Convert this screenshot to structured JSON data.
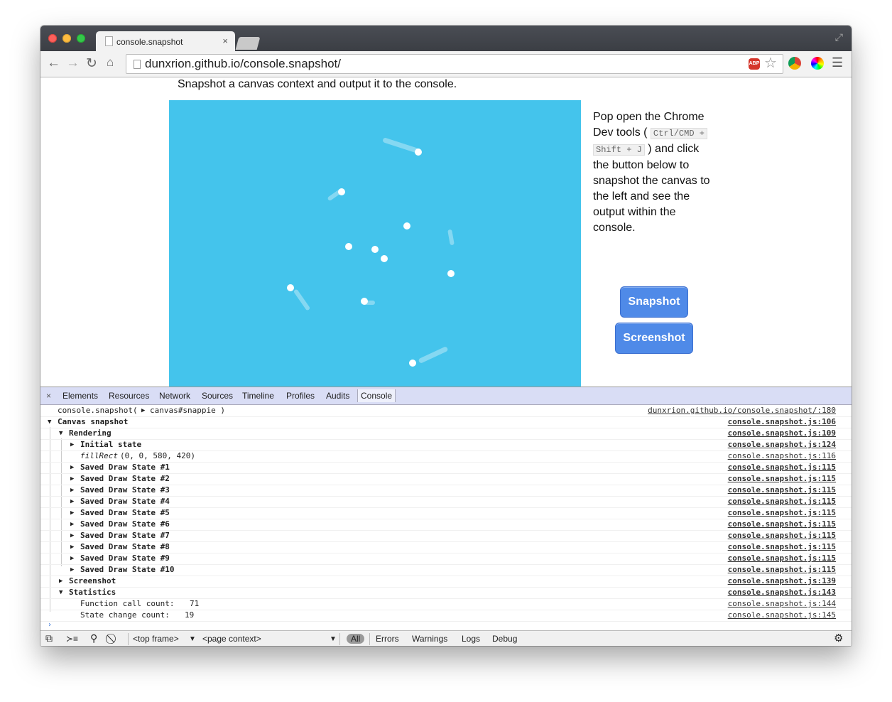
{
  "browser": {
    "tab_title": "console.snapshot",
    "tab_close": "×",
    "url": "dunxrion.github.io/console.snapshot/",
    "abp_label": "ABP"
  },
  "page": {
    "heading": "Snapshot a canvas context and output it to the console.",
    "instructions": {
      "part1": "Pop open the Chrome Dev tools (",
      "kbd1": "Ctrl/CMD +",
      "kbd2": "Shift + J",
      "part2": ") and click the button below to snapshot the canvas to the left and see the output within the console."
    },
    "buttons": {
      "snapshot": "Snapshot",
      "screenshot": "Screenshot"
    },
    "canvas_color": "#44c4ec"
  },
  "devtools": {
    "close": "×",
    "tabs": [
      "Elements",
      "Resources",
      "Network",
      "Sources",
      "Timeline",
      "Profiles",
      "Audits",
      "Console"
    ],
    "active_tab": "Console",
    "console_rows": [
      {
        "text": "console.snapshot(",
        "extra": "canvas#snappie )",
        "src": "dunxrion.github.io/console.snapshot/:180"
      },
      {
        "text": "Canvas snapshot",
        "src": "console.snapshot.js:106"
      },
      {
        "text": "Rendering",
        "src": "console.snapshot.js:109"
      },
      {
        "text": "Initial state",
        "src": "console.snapshot.js:124"
      },
      {
        "text": "fillRect",
        "extra": "(0, 0, 580, 420)",
        "src": "console.snapshot.js:116"
      },
      {
        "text": "Saved Draw State #1",
        "src": "console.snapshot.js:115"
      },
      {
        "text": "Saved Draw State #2",
        "src": "console.snapshot.js:115"
      },
      {
        "text": "Saved Draw State #3",
        "src": "console.snapshot.js:115"
      },
      {
        "text": "Saved Draw State #4",
        "src": "console.snapshot.js:115"
      },
      {
        "text": "Saved Draw State #5",
        "src": "console.snapshot.js:115"
      },
      {
        "text": "Saved Draw State #6",
        "src": "console.snapshot.js:115"
      },
      {
        "text": "Saved Draw State #7",
        "src": "console.snapshot.js:115"
      },
      {
        "text": "Saved Draw State #8",
        "src": "console.snapshot.js:115"
      },
      {
        "text": "Saved Draw State #9",
        "src": "console.snapshot.js:115"
      },
      {
        "text": "Saved Draw State #10",
        "src": "console.snapshot.js:115"
      },
      {
        "text": "Screenshot",
        "src": "console.snapshot.js:139"
      },
      {
        "text": "Statistics",
        "src": "console.snapshot.js:143"
      },
      {
        "text": "Function call count:",
        "value": "71",
        "src": "console.snapshot.js:144"
      },
      {
        "text": "State change count:",
        "value": "19",
        "src": "console.snapshot.js:145"
      }
    ],
    "bottom": {
      "frame": "<top frame>",
      "context": "<page context>",
      "filters": [
        "All",
        "Errors",
        "Warnings",
        "Logs",
        "Debug"
      ]
    }
  }
}
